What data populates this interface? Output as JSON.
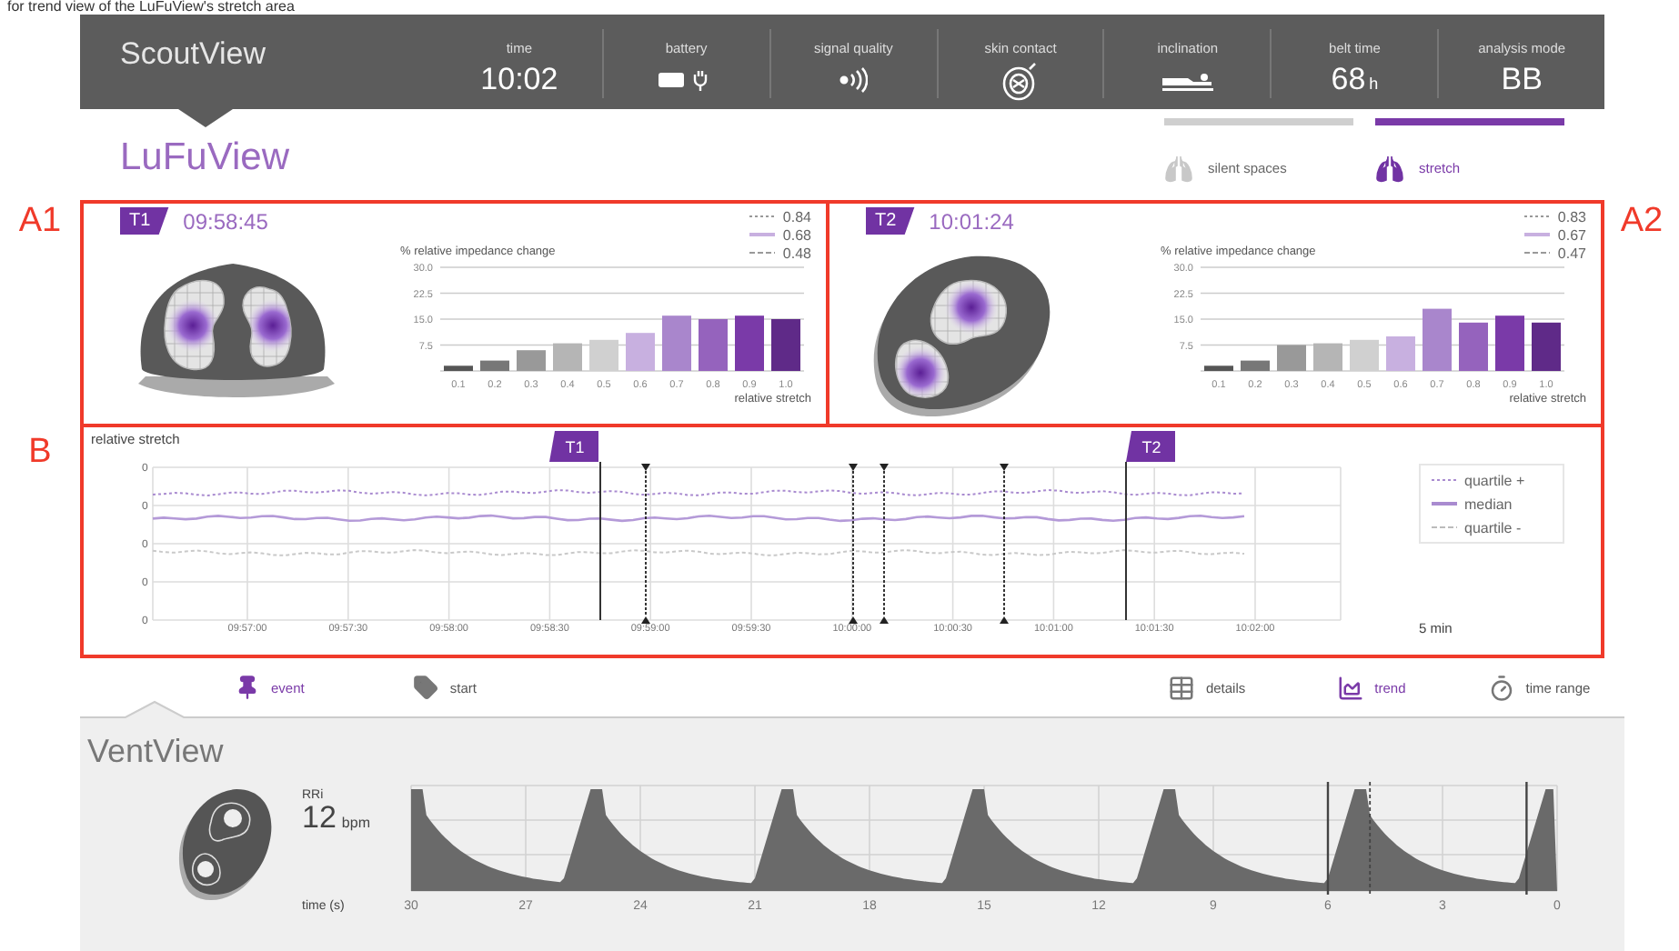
{
  "caption": "for trend view of the LuFuView's stretch area",
  "annotations": [
    {
      "label": "A1"
    },
    {
      "label": "A2"
    },
    {
      "label": "B"
    }
  ],
  "header": {
    "title": "ScoutView",
    "items": [
      {
        "label": "time",
        "kind": "text",
        "value": "10:02"
      },
      {
        "label": "battery",
        "kind": "battery"
      },
      {
        "label": "signal quality",
        "kind": "signal"
      },
      {
        "label": "skin contact",
        "kind": "skin"
      },
      {
        "label": "inclination",
        "kind": "inclination"
      },
      {
        "label": "belt time",
        "kind": "text",
        "value": "68",
        "unit": "h"
      },
      {
        "label": "analysis mode",
        "kind": "text",
        "value": "BB"
      }
    ]
  },
  "lufuview": {
    "title": "LuFuView",
    "modes": [
      {
        "label": "silent spaces",
        "selected": false
      },
      {
        "label": "stretch",
        "selected": true
      }
    ],
    "panels": [
      {
        "tag": "T1",
        "time": "09:58:45",
        "kind": "upright",
        "legend": [
          {
            "value": "0.84",
            "kind": "dotted"
          },
          {
            "value": "0.68",
            "kind": "solid"
          },
          {
            "value": "0.48",
            "kind": "dashed"
          }
        ],
        "chart_data": {
          "type": "bar",
          "ylabel": "% relative impedance change",
          "xlabel": "relative stretch",
          "categories": [
            "0.1",
            "0.2",
            "0.3",
            "0.4",
            "0.5",
            "0.6",
            "0.7",
            "0.8",
            "0.9",
            "1.0"
          ],
          "grid": true,
          "values": [
            1.5,
            3,
            6,
            8,
            9,
            11,
            16,
            15,
            16,
            15
          ],
          "colors": [
            "#555555",
            "#777777",
            "#999999",
            "#b5b5b5",
            "#d0d0d0",
            "#c8b0e0",
            "#a986cc",
            "#9563bd",
            "#7a3aa8",
            "#5f2a88"
          ],
          "ylim": [
            0,
            30
          ],
          "yticks": [
            {
              "value": 7.5,
              "label": "7.5"
            },
            {
              "value": 15,
              "label": "15.0"
            },
            {
              "value": 22.5,
              "label": "22.5"
            },
            {
              "value": 30,
              "label": "30.0"
            }
          ]
        }
      },
      {
        "tag": "T2",
        "time": "10:01:24",
        "kind": "tilted",
        "legend": [
          {
            "value": "0.83",
            "kind": "dotted"
          },
          {
            "value": "0.67",
            "kind": "solid"
          },
          {
            "value": "0.47",
            "kind": "dashed"
          }
        ],
        "chart_data": {
          "type": "bar",
          "ylabel": "% relative impedance change",
          "xlabel": "relative stretch",
          "categories": [
            "0.1",
            "0.2",
            "0.3",
            "0.4",
            "0.5",
            "0.6",
            "0.7",
            "0.8",
            "0.9",
            "1.0"
          ],
          "grid": true,
          "values": [
            1.5,
            3,
            7.5,
            8,
            9,
            10,
            18,
            14,
            16,
            14
          ],
          "colors": [
            "#555555",
            "#777777",
            "#999999",
            "#b5b5b5",
            "#d0d0d0",
            "#c8b0e0",
            "#a986cc",
            "#9563bd",
            "#7a3aa8",
            "#5f2a88"
          ],
          "ylim": [
            0,
            30
          ],
          "yticks": [
            {
              "value": 7.5,
              "label": "7.5"
            },
            {
              "value": 15,
              "label": "15.0"
            },
            {
              "value": 22.5,
              "label": "22.5"
            },
            {
              "value": 30,
              "label": "30.0"
            }
          ]
        }
      }
    ]
  },
  "trend": {
    "ylabel": "relative stretch",
    "yticks": [
      "0",
      "0",
      "0",
      "0",
      "0"
    ],
    "xticks": [
      "09:57:00",
      "09:57:30",
      "09:58:00",
      "09:58:30",
      "09:59:00",
      "09:59:30",
      "10:00:00",
      "10:00:30",
      "10:01:00",
      "10:01:30",
      "10:02:00"
    ],
    "markers": [
      {
        "tag": "T1"
      },
      {
        "tag": "T2"
      }
    ],
    "legend": [
      {
        "label": "quartile +",
        "kind": "dotted"
      },
      {
        "label": "median",
        "kind": "solid"
      },
      {
        "label": "quartile -",
        "kind": "dashed"
      }
    ],
    "span": "5 min"
  },
  "toolbar": [
    {
      "label": "event",
      "kind": "event",
      "selected": true
    },
    {
      "label": "start",
      "kind": "start",
      "selected": false
    },
    {
      "label": "details",
      "kind": "details",
      "selected": false
    },
    {
      "label": "trend",
      "kind": "trend",
      "selected": true
    },
    {
      "label": "time range",
      "kind": "time",
      "selected": false
    }
  ],
  "ventview": {
    "title": "VentView",
    "rate_label": "RRi",
    "rate": "12",
    "rate_unit": "bpm",
    "xlabel": "time (s)",
    "xticks": [
      "30",
      "27",
      "24",
      "21",
      "18",
      "15",
      "12",
      "9",
      "6",
      "3",
      "0"
    ]
  }
}
